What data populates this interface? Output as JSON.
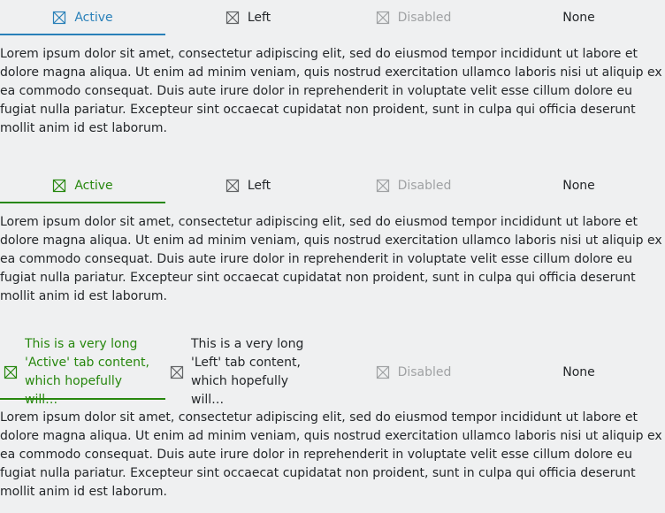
{
  "tab_groups": [
    {
      "tabs": [
        {
          "label": "Active",
          "state": "active",
          "icon": "tab-icon"
        },
        {
          "label": "Left",
          "state": "normal",
          "icon": "tab-icon"
        },
        {
          "label": "Disabled",
          "state": "disabled",
          "icon": "tab-icon"
        },
        {
          "label": "None",
          "state": "normal",
          "icon": ""
        }
      ],
      "accent_color": "#2980b9",
      "content": "Lorem ipsum dolor sit amet, consectetur adipiscing elit, sed do eiusmod tempor incididunt ut labore et dolore magna aliqua. Ut enim ad minim veniam, quis nostrud exercitation ullamco laboris nisi ut aliquip ex ea commodo consequat. Duis aute irure dolor in reprehenderit in voluptate velit esse cillum dolore eu fugiat nulla pariatur. Excepteur sint occaecat cupidatat non proident, sunt in culpa qui officia deserunt mollit anim id est laborum."
    },
    {
      "tabs": [
        {
          "label": "Active",
          "state": "active",
          "icon": "tab-icon"
        },
        {
          "label": "Left",
          "state": "normal",
          "icon": "tab-icon"
        },
        {
          "label": "Disabled",
          "state": "disabled",
          "icon": "tab-icon"
        },
        {
          "label": "None",
          "state": "normal",
          "icon": ""
        }
      ],
      "accent_color": "#27870e",
      "content": "Lorem ipsum dolor sit amet, consectetur adipiscing elit, sed do eiusmod tempor incididunt ut labore et dolore magna aliqua. Ut enim ad minim veniam, quis nostrud exercitation ullamco laboris nisi ut aliquip ex ea commodo consequat. Duis aute irure dolor in reprehenderit in voluptate velit esse cillum dolore eu fugiat nulla pariatur. Excepteur sint occaecat cupidatat non proident, sunt in culpa qui officia deserunt mollit anim id est laborum."
    },
    {
      "tabs": [
        {
          "label": "This is a very long 'Active' tab content, which hopefully will…",
          "state": "active",
          "icon": "tab-icon"
        },
        {
          "label": "This is a very long 'Left' tab content, which hopefully will…",
          "state": "normal",
          "icon": "tab-icon"
        },
        {
          "label": "Disabled",
          "state": "disabled",
          "icon": "tab-icon"
        },
        {
          "label": "None",
          "state": "normal",
          "icon": ""
        }
      ],
      "accent_color": "#27870e",
      "content": "Lorem ipsum dolor sit amet, consectetur adipiscing elit, sed do eiusmod tempor incididunt ut labore et dolore magna aliqua. Ut enim ad minim veniam, quis nostrud exercitation ullamco laboris nisi ut aliquip ex ea commodo consequat. Duis aute irure dolor in reprehenderit in voluptate velit esse cillum dolore eu fugiat nulla pariatur. Excepteur sint occaecat cupidatat non proident, sunt in culpa qui officia deserunt mollit anim id est laborum."
    }
  ]
}
